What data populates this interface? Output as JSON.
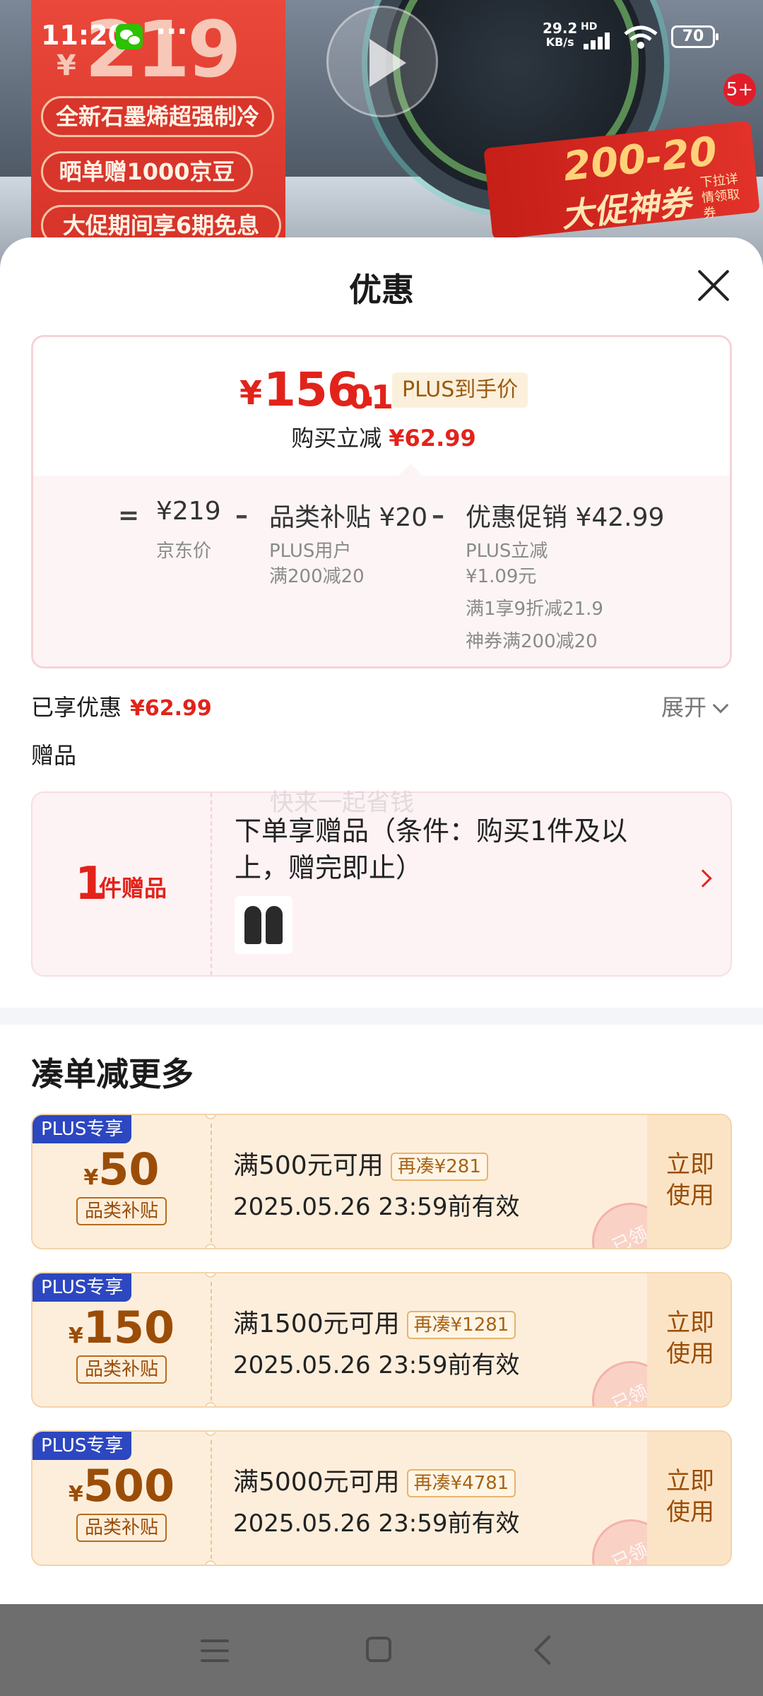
{
  "status_bar": {
    "time": "11:20",
    "net_speed_value": "29.2",
    "net_speed_unit": "KB/s",
    "hd_label": "HD",
    "battery": "70"
  },
  "banner": {
    "promo_yen": "¥",
    "promo_price": "219",
    "promo_line1": "全新石墨烯超强制冷",
    "promo_line2": "晒单赠1000京豆",
    "promo_line3": "大促期间享6期免息",
    "coupon_big": "200-20",
    "coupon_sub": "大促神券",
    "coupon_tiny": "下拉详情领取券",
    "badge_count": "5+"
  },
  "sheet": {
    "title": "优惠",
    "price_box": {
      "yen": "¥",
      "price_int": "156.",
      "price_dec": "01",
      "plus_tag": "PLUS到手价",
      "discount_label": "购买立减",
      "discount_value": "¥62.99",
      "breakdown": {
        "eq": "=",
        "minus": "–",
        "jd_price": "¥219",
        "jd_price_label": "京东价",
        "subsidy_head": "品类补贴 ¥20",
        "subsidy_line1": "PLUS用户",
        "subsidy_line2": "满200减20",
        "promo_head": "优惠促销 ¥42.99",
        "promo_line1": "PLUS立减",
        "promo_line2": "¥1.09元",
        "promo_line3": "满1享9折减21.9",
        "promo_line4": "神券满200减20"
      }
    },
    "enjoyed_label": "已享优惠",
    "enjoyed_value": "¥62.99",
    "expand_label": "展开",
    "gift_label": "赠品",
    "gift": {
      "count": "1",
      "unit": "件赠品",
      "text": "下单享赠品（条件：购买1件及以上，赠完即止）",
      "watermark": "快来一起省钱"
    },
    "more_title": "凑单减更多",
    "coupons": [
      {
        "plus_label": "PLUS专享",
        "yen": "¥",
        "amount": "50",
        "type": "品类补贴",
        "condition": "满500元可用",
        "tag": "再凑¥281",
        "valid": "2025.05.26 23:59前有效",
        "btn_line1": "立即",
        "btn_line2": "使用",
        "stamp": "已领"
      },
      {
        "plus_label": "PLUS专享",
        "yen": "¥",
        "amount": "150",
        "type": "品类补贴",
        "condition": "满1500元可用",
        "tag": "再凑¥1281",
        "valid": "2025.05.26 23:59前有效",
        "btn_line1": "立即",
        "btn_line2": "使用",
        "stamp": "已领"
      },
      {
        "plus_label": "PLUS专享",
        "yen": "¥",
        "amount": "500",
        "type": "品类补贴",
        "condition": "满5000元可用",
        "tag": "再凑¥4781",
        "valid": "2025.05.26 23:59前有效",
        "btn_line1": "立即",
        "btn_line2": "使用",
        "stamp": "已领"
      }
    ]
  },
  "colors": {
    "accent_red": "#e2231a",
    "coupon_brown": "#9b4d07",
    "plus_blue": "#2d47c0"
  },
  "icons": [
    "wechat-icon",
    "more-dots-icon",
    "signal-icon",
    "wifi-icon",
    "battery-icon",
    "play-icon",
    "close-icon",
    "chevron-down-icon",
    "chevron-right-icon",
    "menu-icon",
    "home-icon",
    "back-icon"
  ]
}
